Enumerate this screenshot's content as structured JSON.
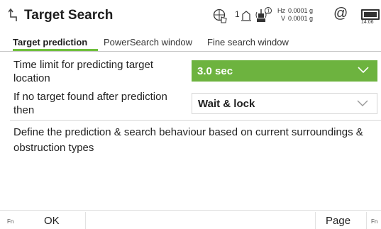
{
  "header": {
    "title": "Target Search",
    "hz_label": "Hz",
    "hz_value": "0.0001 g",
    "v_label": "V",
    "v_value": "0.0001 g",
    "face_indicator": "1",
    "time": "14:06"
  },
  "tabs": [
    {
      "label": "Target prediction",
      "active": true
    },
    {
      "label": "PowerSearch window",
      "active": false
    },
    {
      "label": "Fine search window",
      "active": false
    }
  ],
  "fields": {
    "time_limit": {
      "label": "Time limit for predicting target location",
      "value": "3.0 sec"
    },
    "no_target": {
      "label": "If no target found after prediction then",
      "value": "Wait & lock"
    }
  },
  "description": "Define the prediction & search behaviour based on current surroundings & obstruction types",
  "softkeys": {
    "fn_left": "Fn",
    "ok": "OK",
    "page": "Page",
    "fn_right": "Fn"
  },
  "colors": {
    "accent_green": "#6db33f",
    "tab_underline": "#6fbf3c"
  },
  "icons": [
    "back-arrow-icon",
    "crosshair-hand-icon",
    "face-one-icon",
    "instrument-target-icon",
    "at-icon",
    "battery-icon",
    "chevron-down-icon"
  ]
}
